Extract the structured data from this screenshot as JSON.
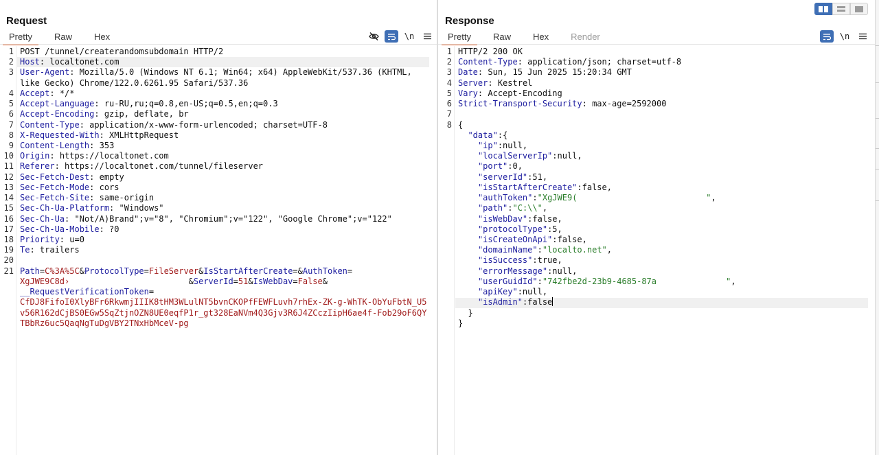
{
  "request": {
    "title": "Request",
    "tabs": [
      "Pretty",
      "Raw",
      "Hex"
    ],
    "active_tab": "Pretty",
    "tools": {
      "hide_icon": "eye-off-icon",
      "wrap_icon": "wrap-lines-icon",
      "newline_label": "\\n",
      "menu_icon": "menu-icon"
    },
    "line_numbers": [
      "1",
      "2",
      "3",
      "4",
      "5",
      "6",
      "7",
      "8",
      "9",
      "10",
      "11",
      "12",
      "13",
      "14",
      "15",
      "16",
      "17",
      "18",
      "19",
      "20",
      "21"
    ],
    "lines": [
      {
        "key": "",
        "val": "POST /tunnel/createrandomsubdomain HTTP/2"
      },
      {
        "key": "Host",
        "val": " localtonet.com"
      },
      {
        "key": "User-Agent",
        "val": " Mozilla/5.0 (Windows NT 6.1; Win64; x64) AppleWebKit/537.36 (KHTML,"
      },
      {
        "key": "",
        "val": "like Gecko) Chrome/122.0.6261.95 Safari/537.36"
      },
      {
        "key": "Accept",
        "val": " */*"
      },
      {
        "key": "Accept-Language",
        "val": " ru-RU,ru;q=0.8,en-US;q=0.5,en;q=0.3"
      },
      {
        "key": "Accept-Encoding",
        "val": " gzip, deflate, br"
      },
      {
        "key": "Content-Type",
        "val": " application/x-www-form-urlencoded; charset=UTF-8"
      },
      {
        "key": "X-Requested-With",
        "val": " XMLHttpRequest"
      },
      {
        "key": "Content-Length",
        "val": " 353"
      },
      {
        "key": "Origin",
        "val": " https://localtonet.com"
      },
      {
        "key": "Referer",
        "val": " https://localtonet.com/tunnel/fileserver"
      },
      {
        "key": "Sec-Fetch-Dest",
        "val": " empty"
      },
      {
        "key": "Sec-Fetch-Mode",
        "val": " cors"
      },
      {
        "key": "Sec-Fetch-Site",
        "val": " same-origin"
      },
      {
        "key": "Sec-Ch-Ua-Platform",
        "val": " \"Windows\""
      },
      {
        "key": "Sec-Ch-Ua",
        "val": " \"Not/A)Brand\";v=\"8\", \"Chromium\";v=\"122\", \"Google Chrome\";v=\"122\""
      },
      {
        "key": "Sec-Ch-Ua-Mobile",
        "val": " ?0"
      },
      {
        "key": "Priority",
        "val": " u=0"
      },
      {
        "key": "Te",
        "val": " trailers"
      },
      {
        "key": "",
        "val": ""
      }
    ],
    "body": {
      "line1": [
        {
          "t": "Path",
          "c": "pk"
        },
        {
          "t": "=",
          "c": ""
        },
        {
          "t": "C%3A%5C",
          "c": "pv"
        },
        {
          "t": "&",
          "c": ""
        },
        {
          "t": "ProtocolType",
          "c": "pk"
        },
        {
          "t": "=",
          "c": ""
        },
        {
          "t": "FileServer",
          "c": "pv"
        },
        {
          "t": "&",
          "c": ""
        },
        {
          "t": "IsStartAfterCreate",
          "c": "pk"
        },
        {
          "t": "=&",
          "c": ""
        },
        {
          "t": "AuthToken",
          "c": "pk"
        },
        {
          "t": "=",
          "c": ""
        }
      ],
      "line2": [
        {
          "t": "XgJWE9C8d›",
          "c": "pv"
        },
        {
          "t": "                        &",
          "c": ""
        },
        {
          "t": "ServerId",
          "c": "pk"
        },
        {
          "t": "=",
          "c": ""
        },
        {
          "t": "51",
          "c": "pv"
        },
        {
          "t": "&",
          "c": ""
        },
        {
          "t": "IsWebDav",
          "c": "pk"
        },
        {
          "t": "=",
          "c": ""
        },
        {
          "t": "False",
          "c": "pv"
        },
        {
          "t": "&",
          "c": ""
        }
      ],
      "line3": [
        {
          "t": "__RequestVerificationToken",
          "c": "pk"
        },
        {
          "t": "=",
          "c": ""
        }
      ],
      "line4": [
        {
          "t": "CfDJ8FifoI0XlyBFr6RkwmjIIIK8tHM3WLulNT5bvnCKOPfFEWFLuvh7rhEx-ZK-g-WhTK-ObYuFbtN_U5",
          "c": "pv"
        }
      ],
      "line5": [
        {
          "t": "v56R162dCjBS0EGw5SqZtjnOZN8UE0eqfP1r_gt328EaNVm4Q3Gjv3R6J4ZCczIipH6ae4f-Fob29oF6QY",
          "c": "pv"
        }
      ],
      "line6": [
        {
          "t": "TBbRz6uc5QaqNgTuDgVBY2TNxHbMceV-pg",
          "c": "pv"
        }
      ]
    }
  },
  "response": {
    "title": "Response",
    "tabs": [
      "Pretty",
      "Raw",
      "Hex",
      "Render"
    ],
    "active_tab": "Pretty",
    "tools": {
      "wrap_icon": "wrap-lines-icon",
      "newline_label": "\\n",
      "menu_icon": "menu-icon"
    },
    "line_numbers": [
      "1",
      "2",
      "3",
      "4",
      "5",
      "6",
      "7",
      "8"
    ],
    "headers": [
      {
        "key": "",
        "val": "HTTP/2 200 OK"
      },
      {
        "key": "Content-Type",
        "val": " application/json; charset=utf-8"
      },
      {
        "key": "Date",
        "val": " Sun, 15 Jun 2025 15:20:34 GMT"
      },
      {
        "key": "Server",
        "val": " Kestrel"
      },
      {
        "key": "Vary",
        "val": " Accept-Encoding"
      },
      {
        "key": "Strict-Transport-Security",
        "val": " max-age=2592000"
      },
      {
        "key": "",
        "val": ""
      }
    ],
    "json_lines": [
      [
        {
          "t": "{",
          "c": ""
        }
      ],
      [
        {
          "t": "  ",
          "c": ""
        },
        {
          "t": "\"data\"",
          "c": "k"
        },
        {
          "t": ":{",
          "c": ""
        }
      ],
      [
        {
          "t": "    ",
          "c": ""
        },
        {
          "t": "\"ip\"",
          "c": "k"
        },
        {
          "t": ":null,",
          "c": ""
        }
      ],
      [
        {
          "t": "    ",
          "c": ""
        },
        {
          "t": "\"localServerIp\"",
          "c": "k"
        },
        {
          "t": ":null,",
          "c": ""
        }
      ],
      [
        {
          "t": "    ",
          "c": ""
        },
        {
          "t": "\"port\"",
          "c": "k"
        },
        {
          "t": ":0,",
          "c": ""
        }
      ],
      [
        {
          "t": "    ",
          "c": ""
        },
        {
          "t": "\"serverId\"",
          "c": "k"
        },
        {
          "t": ":51,",
          "c": ""
        }
      ],
      [
        {
          "t": "    ",
          "c": ""
        },
        {
          "t": "\"isStartAfterCreate\"",
          "c": "k"
        },
        {
          "t": ":false,",
          "c": ""
        }
      ],
      [
        {
          "t": "    ",
          "c": ""
        },
        {
          "t": "\"authToken\"",
          "c": "k"
        },
        {
          "t": ":",
          "c": ""
        },
        {
          "t": "\"XgJWE9(                          \"",
          "c": "s"
        },
        {
          "t": ",",
          "c": ""
        }
      ],
      [
        {
          "t": "    ",
          "c": ""
        },
        {
          "t": "\"path\"",
          "c": "k"
        },
        {
          "t": ":",
          "c": ""
        },
        {
          "t": "\"C:\\\\\"",
          "c": "s"
        },
        {
          "t": ",",
          "c": ""
        }
      ],
      [
        {
          "t": "    ",
          "c": ""
        },
        {
          "t": "\"isWebDav\"",
          "c": "k"
        },
        {
          "t": ":false,",
          "c": ""
        }
      ],
      [
        {
          "t": "    ",
          "c": ""
        },
        {
          "t": "\"protocolType\"",
          "c": "k"
        },
        {
          "t": ":5,",
          "c": ""
        }
      ],
      [
        {
          "t": "    ",
          "c": ""
        },
        {
          "t": "\"isCreateOnApi\"",
          "c": "k"
        },
        {
          "t": ":false,",
          "c": ""
        }
      ],
      [
        {
          "t": "    ",
          "c": ""
        },
        {
          "t": "\"domainName\"",
          "c": "k"
        },
        {
          "t": ":",
          "c": ""
        },
        {
          "t": "\"localto.net\"",
          "c": "s"
        },
        {
          "t": ",",
          "c": ""
        }
      ],
      [
        {
          "t": "    ",
          "c": ""
        },
        {
          "t": "\"isSuccess\"",
          "c": "k"
        },
        {
          "t": ":true,",
          "c": ""
        }
      ],
      [
        {
          "t": "    ",
          "c": ""
        },
        {
          "t": "\"errorMessage\"",
          "c": "k"
        },
        {
          "t": ":null,",
          "c": ""
        }
      ],
      [
        {
          "t": "    ",
          "c": ""
        },
        {
          "t": "\"userGuidId\"",
          "c": "k"
        },
        {
          "t": ":",
          "c": ""
        },
        {
          "t": "\"742fbe2d-23b9-4685-87a              \"",
          "c": "s"
        },
        {
          "t": ",",
          "c": ""
        }
      ],
      [
        {
          "t": "    ",
          "c": ""
        },
        {
          "t": "\"apiKey\"",
          "c": "k"
        },
        {
          "t": ":null,",
          "c": ""
        }
      ],
      [
        {
          "t": "    ",
          "c": ""
        },
        {
          "t": "\"isAdmin\"",
          "c": "k"
        },
        {
          "t": ":false",
          "c": ""
        }
      ],
      [
        {
          "t": "  }",
          "c": ""
        }
      ],
      [
        {
          "t": "}",
          "c": ""
        }
      ]
    ]
  },
  "layout_buttons": [
    "side-by-side-layout-icon",
    "top-bottom-layout-icon",
    "single-pane-layout-icon"
  ],
  "colors": {
    "accent": "#e8632b",
    "key_blue": "#1d1d9f",
    "param_value_red": "#a11b1b",
    "string_green": "#2a7d2a",
    "toggle_blue": "#3f6fb5"
  }
}
